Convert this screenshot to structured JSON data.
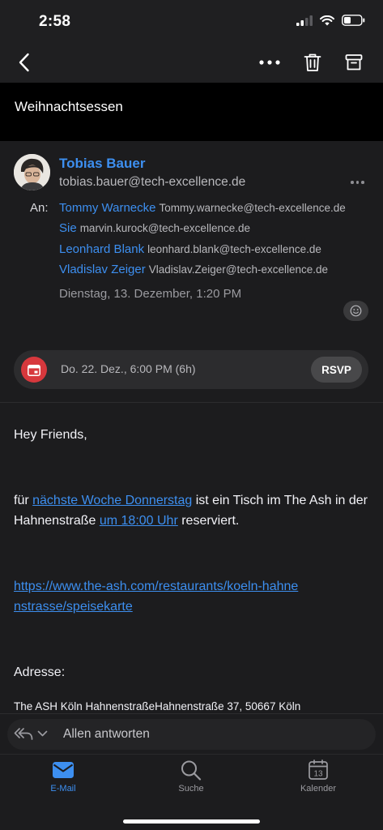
{
  "status_bar": {
    "time": "2:58"
  },
  "toolbar": {
    "back": "back",
    "more": "more",
    "delete": "delete",
    "archive": "archive"
  },
  "email": {
    "subject": "Weihnachtsessen",
    "sender": {
      "name": "Tobias Bauer",
      "email": "tobias.bauer@tech-excellence.de"
    },
    "to_label": "An:",
    "recipients": [
      {
        "name": "Tommy Warnecke",
        "email": "Tommy.warnecke@tech-excellence.de"
      },
      {
        "name": "Sie",
        "email": "marvin.kurock@tech-excellence.de"
      },
      {
        "name": "Leonhard Blank",
        "email": "leonhard.blank@tech-excellence.de"
      },
      {
        "name": "Vladislav Zeiger",
        "email": "Vladislav.Zeiger@tech-excellence.de"
      }
    ],
    "date": "Dienstag, 13. Dezember, 1:20 PM",
    "event": {
      "text": "Do. 22. Dez., 6:00 PM (6h)",
      "rsvp_label": "RSVP"
    },
    "body": {
      "greeting": "Hey Friends,",
      "p1_start": "für ",
      "p1_link1": "nächste Woche Donnerstag",
      "p1_mid": " ist ein Tisch im The Ash in der Hahnenstraße ",
      "p1_link2": "um 18:00 Uhr",
      "p1_end": " reserviert.",
      "url": "https://www.the-ash.com/restaurants/koeln-hahnenstrasse/speisekarte",
      "address_label": "Adresse:",
      "address": "The ASH Köln HahnenstraßeHahnenstraße 37, 50667 Köln"
    }
  },
  "reply": {
    "placeholder": "Allen antworten"
  },
  "tabs": [
    {
      "label": "E-Mail",
      "icon": "mail-icon",
      "active": true
    },
    {
      "label": "Suche",
      "icon": "search-icon",
      "active": false
    },
    {
      "label": "Kalender",
      "icon": "calendar-icon",
      "active": false,
      "day": "13"
    }
  ],
  "colors": {
    "accent": "#3d8ff0",
    "event": "#d7383d",
    "background": "#1c1c1e"
  }
}
